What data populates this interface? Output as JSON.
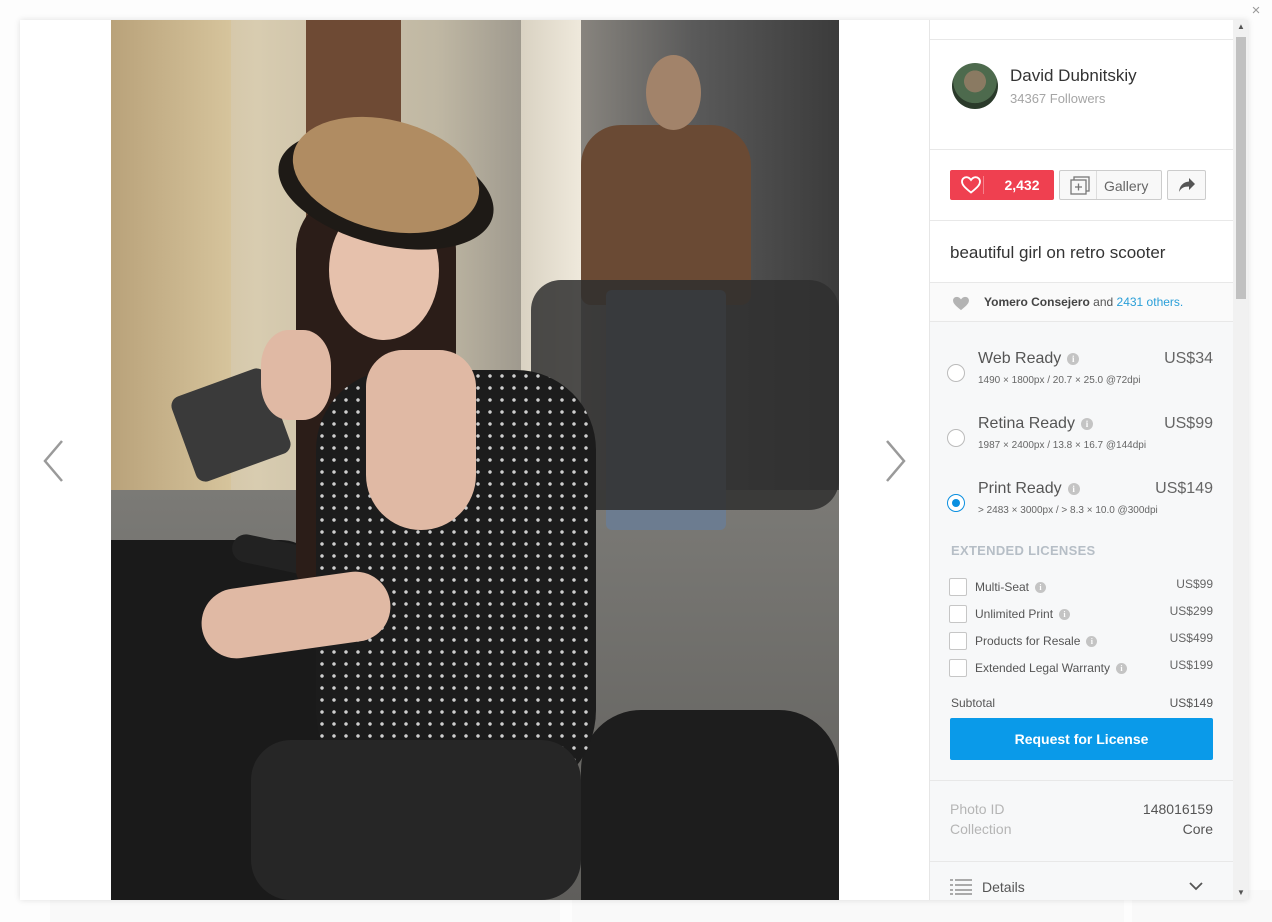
{
  "window": {
    "close_glyph": "×"
  },
  "author": {
    "name": "David Dubnitskiy",
    "followers": "34367 Followers"
  },
  "actions": {
    "likes": "2,432",
    "gallery_label": "Gallery"
  },
  "photo": {
    "title": "beautiful girl on retro scooter"
  },
  "likers": {
    "first": "Yomero Consejero",
    "connector": "and",
    "others": "2431 others."
  },
  "license": {
    "options": [
      {
        "name": "Web Ready",
        "dims": "1490 × 1800px / 20.7 × 25.0 @72dpi",
        "price": "US$34",
        "selected": false
      },
      {
        "name": "Retina Ready",
        "dims": "1987 × 2400px / 13.8 × 16.7 @144dpi",
        "price": "US$99",
        "selected": false
      },
      {
        "name": "Print Ready",
        "dims": "> 2483 × 3000px / > 8.3 × 10.0 @300dpi",
        "price": "US$149",
        "selected": true
      }
    ],
    "extended_title": "EXTENDED LICENSES",
    "extended": [
      {
        "name": "Multi-Seat",
        "price": "US$99"
      },
      {
        "name": "Unlimited Print",
        "price": "US$299"
      },
      {
        "name": "Products for Resale",
        "price": "US$499"
      },
      {
        "name": "Extended Legal Warranty",
        "price": "US$199"
      }
    ],
    "subtotal_label": "Subtotal",
    "subtotal_value": "US$149",
    "request_label": "Request for License"
  },
  "meta": {
    "photo_id_label": "Photo ID",
    "photo_id": "148016159",
    "collection_label": "Collection",
    "collection": "Core"
  },
  "details_label": "Details",
  "colors": {
    "like": "#ef4050",
    "primary": "#0a9ae9",
    "link": "#2a9fd8"
  }
}
